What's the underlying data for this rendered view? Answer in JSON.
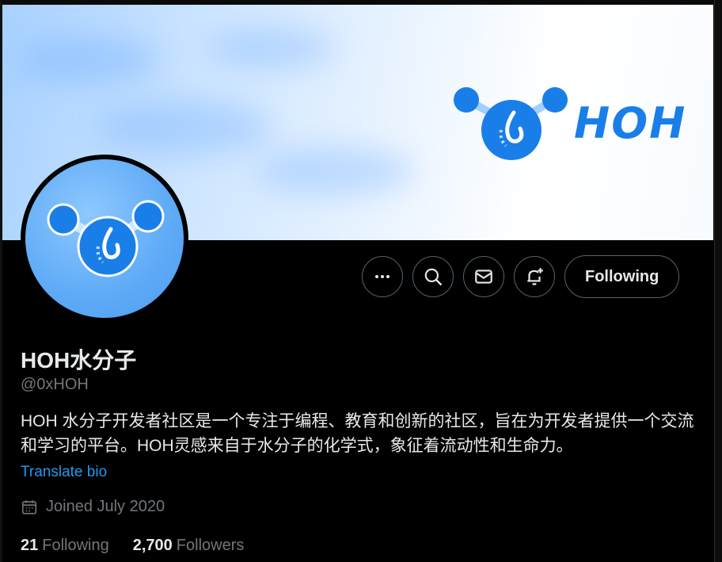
{
  "banner": {
    "brand_text": "HOH"
  },
  "actions": {
    "more_icon": "more-icon",
    "search_icon": "search-icon",
    "message_icon": "mail-icon",
    "notify_icon": "bell-plus-icon",
    "follow_label": "Following"
  },
  "profile": {
    "name": "HOH水分子",
    "handle": "@0xHOH",
    "bio": "HOH 水分子开发者社区是一个专注于编程、教育和创新的社区，旨在为开发者提供一个交流和学习的平台。HOH灵感来自于水分子的化学式，象征着流动性和生命力。",
    "translate_label": "Translate bio",
    "joined": "Joined July 2020",
    "following_count": "21",
    "following_label": "Following",
    "followers_count": "2,700",
    "followers_label": "Followers"
  },
  "colors": {
    "accent": "#1d9bf0",
    "brand_blue": "#1a7ee8",
    "muted": "#71767b",
    "border": "#536471"
  }
}
